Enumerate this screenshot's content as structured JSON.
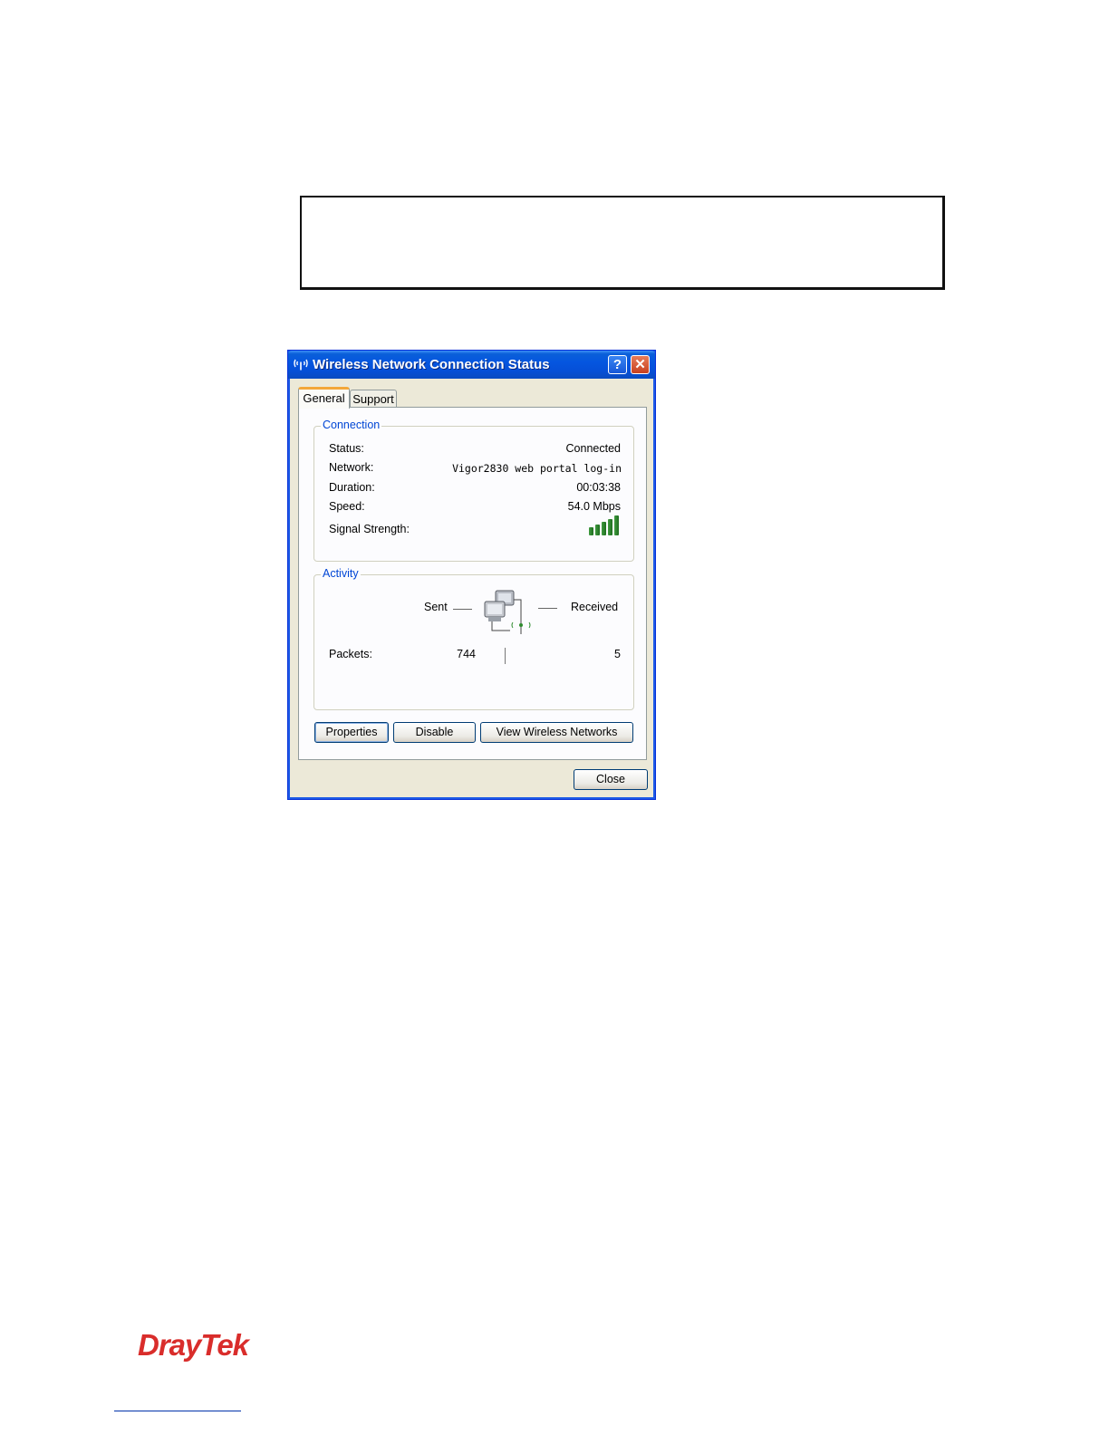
{
  "dialog": {
    "title": "Wireless Network Connection Status",
    "help_label": "?",
    "close_x_label": "✕",
    "tabs": [
      {
        "label": "General",
        "active": true
      },
      {
        "label": "Support",
        "active": false
      }
    ]
  },
  "connection": {
    "group_label": "Connection",
    "rows": [
      {
        "label": "Status:",
        "value": "Connected"
      },
      {
        "label": "Network:",
        "value": "Vigor2830 web portal log-in"
      },
      {
        "label": "Duration:",
        "value": "00:03:38"
      },
      {
        "label": "Speed:",
        "value": "54.0 Mbps"
      },
      {
        "label": "Signal Strength:"
      }
    ],
    "signal_bars": 5,
    "signal_color": "#2e8b2e"
  },
  "activity": {
    "group_label": "Activity",
    "sent_label": "Sent",
    "received_label": "Received",
    "packets_label": "Packets:",
    "packets_sent": "744",
    "packets_received": "5"
  },
  "buttons": {
    "properties": "Properties",
    "disable": "Disable",
    "view_networks": "View Wireless Networks",
    "close": "Close"
  },
  "brand": {
    "logo_text": "DrayTek",
    "logo_color": "#d92d2b"
  },
  "colors": {
    "titlebar": "#0556e0",
    "group_label": "#0046d5"
  }
}
